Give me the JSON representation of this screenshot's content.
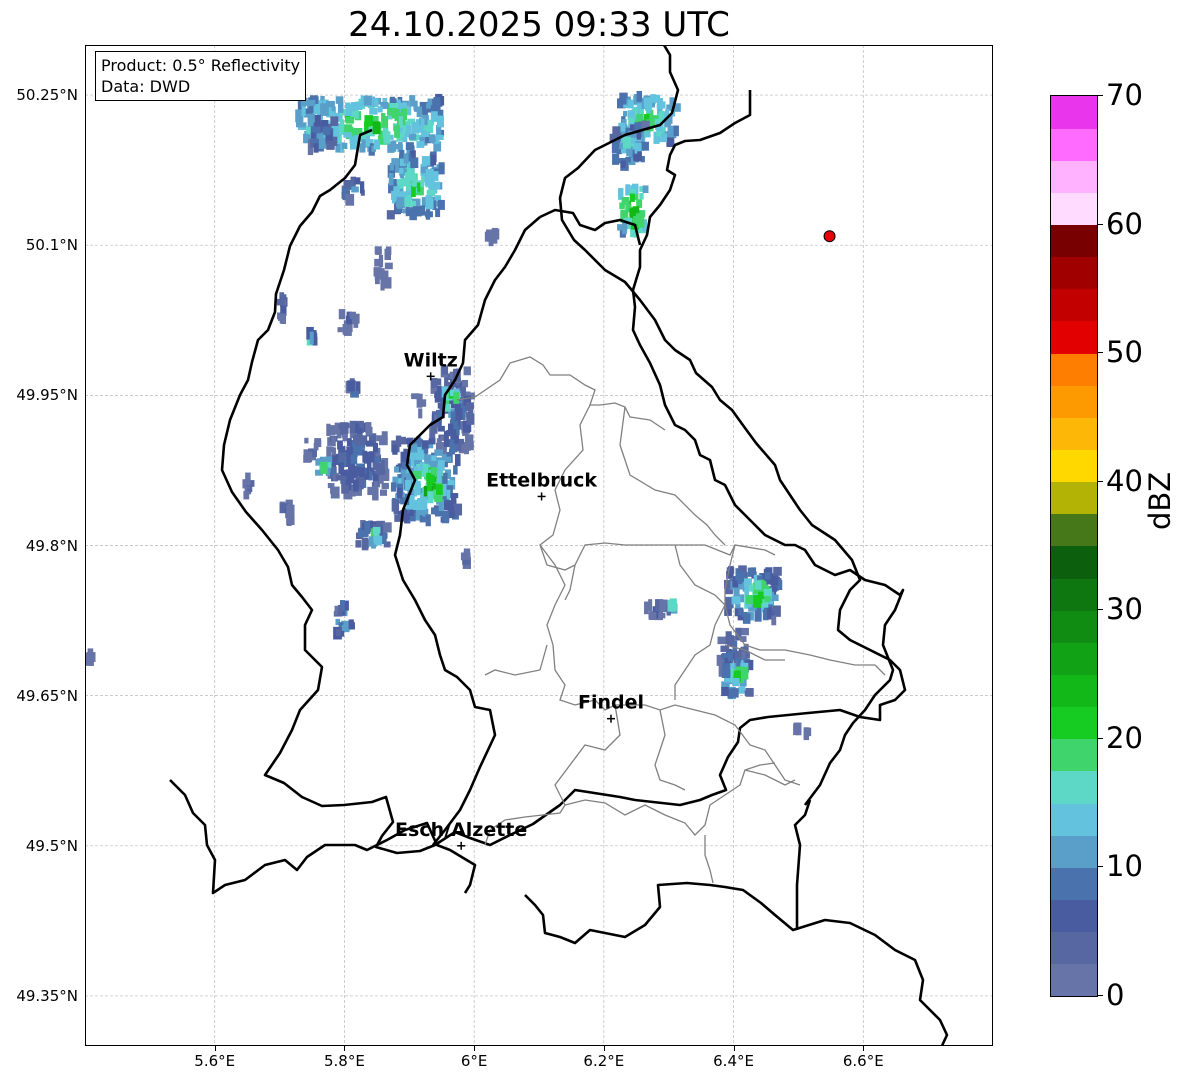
{
  "title": "24.10.2025 09:33 UTC",
  "info": {
    "product": "Product: 0.5° Reflectivity",
    "data": "Data: DWD"
  },
  "map": {
    "lon_range": [
      5.4,
      6.8
    ],
    "lat_range": [
      49.3,
      50.3
    ],
    "lat_ticks": [
      {
        "value": 50.25,
        "label": "50.25°N"
      },
      {
        "value": 50.1,
        "label": "50.1°N"
      },
      {
        "value": 49.95,
        "label": "49.95°N"
      },
      {
        "value": 49.8,
        "label": "49.8°N"
      },
      {
        "value": 49.65,
        "label": "49.65°N"
      },
      {
        "value": 49.5,
        "label": "49.5°N"
      },
      {
        "value": 49.35,
        "label": "49.35°N"
      }
    ],
    "lon_ticks": [
      {
        "value": 5.6,
        "label": "5.6°E"
      },
      {
        "value": 5.8,
        "label": "5.8°E"
      },
      {
        "value": 6.0,
        "label": "6°E"
      },
      {
        "value": 6.2,
        "label": "6.2°E"
      },
      {
        "value": 6.4,
        "label": "6.4°E"
      },
      {
        "value": 6.6,
        "label": "6.6°E"
      }
    ],
    "cities": [
      {
        "name": "Wiltz",
        "lon": 5.933,
        "lat": 49.969
      },
      {
        "name": "Ettelbruck",
        "lon": 6.104,
        "lat": 49.849
      },
      {
        "name": "Findel",
        "lon": 6.211,
        "lat": 49.627
      },
      {
        "name": "Esch/Alzette",
        "lon": 5.98,
        "lat": 49.5
      }
    ],
    "radar_site": {
      "lon": 6.548,
      "lat": 50.109,
      "color": "#e8000b"
    },
    "echoes": [
      {
        "lon": 5.84,
        "lat": 50.22,
        "w": 0.22,
        "h": 0.05,
        "dbz": 22
      },
      {
        "lon": 5.91,
        "lat": 50.16,
        "w": 0.08,
        "h": 0.06,
        "dbz": 20
      },
      {
        "lon": 5.815,
        "lat": 50.155,
        "w": 0.03,
        "h": 0.02,
        "dbz": 15
      },
      {
        "lon": 5.765,
        "lat": 50.21,
        "w": 0.04,
        "h": 0.03,
        "dbz": 14
      },
      {
        "lon": 5.86,
        "lat": 50.08,
        "w": 0.02,
        "h": 0.04,
        "dbz": 5
      },
      {
        "lon": 5.805,
        "lat": 50.025,
        "w": 0.03,
        "h": 0.02,
        "dbz": 6
      },
      {
        "lon": 5.705,
        "lat": 50.04,
        "w": 0.015,
        "h": 0.03,
        "dbz": 8
      },
      {
        "lon": 5.745,
        "lat": 50.005,
        "w": 0.015,
        "h": 0.015,
        "dbz": 18
      },
      {
        "lon": 6.27,
        "lat": 50.225,
        "w": 0.09,
        "h": 0.05,
        "dbz": 20
      },
      {
        "lon": 6.24,
        "lat": 50.2,
        "w": 0.05,
        "h": 0.04,
        "dbz": 17
      },
      {
        "lon": 6.245,
        "lat": 50.135,
        "w": 0.04,
        "h": 0.05,
        "dbz": 24
      },
      {
        "lon": 6.03,
        "lat": 50.108,
        "w": 0.02,
        "h": 0.008,
        "dbz": 6
      },
      {
        "lon": 5.965,
        "lat": 49.935,
        "w": 0.06,
        "h": 0.08,
        "dbz": 12
      },
      {
        "lon": 5.965,
        "lat": 49.945,
        "w": 0.02,
        "h": 0.02,
        "dbz": 24
      },
      {
        "lon": 5.82,
        "lat": 49.885,
        "w": 0.09,
        "h": 0.07,
        "dbz": 12
      },
      {
        "lon": 5.77,
        "lat": 49.88,
        "w": 0.025,
        "h": 0.02,
        "dbz": 18
      },
      {
        "lon": 5.925,
        "lat": 49.865,
        "w": 0.1,
        "h": 0.08,
        "dbz": 18
      },
      {
        "lon": 5.93,
        "lat": 49.86,
        "w": 0.04,
        "h": 0.04,
        "dbz": 26
      },
      {
        "lon": 5.915,
        "lat": 49.94,
        "w": 0.015,
        "h": 0.02,
        "dbz": 4
      },
      {
        "lon": 5.815,
        "lat": 49.955,
        "w": 0.02,
        "h": 0.015,
        "dbz": 13
      },
      {
        "lon": 5.75,
        "lat": 49.895,
        "w": 0.02,
        "h": 0.02,
        "dbz": 3
      },
      {
        "lon": 5.655,
        "lat": 49.86,
        "w": 0.015,
        "h": 0.02,
        "dbz": 4
      },
      {
        "lon": 5.71,
        "lat": 49.835,
        "w": 0.015,
        "h": 0.025,
        "dbz": 10
      },
      {
        "lon": 5.845,
        "lat": 49.81,
        "w": 0.05,
        "h": 0.025,
        "dbz": 14
      },
      {
        "lon": 5.85,
        "lat": 49.81,
        "w": 0.015,
        "h": 0.012,
        "dbz": 22
      },
      {
        "lon": 5.8,
        "lat": 49.725,
        "w": 0.025,
        "h": 0.03,
        "dbz": 16
      },
      {
        "lon": 5.985,
        "lat": 49.785,
        "w": 0.015,
        "h": 0.015,
        "dbz": 6
      },
      {
        "lon": 5.405,
        "lat": 49.685,
        "w": 0.012,
        "h": 0.02,
        "dbz": 4
      },
      {
        "lon": 6.43,
        "lat": 49.75,
        "w": 0.08,
        "h": 0.05,
        "dbz": 17
      },
      {
        "lon": 6.44,
        "lat": 49.75,
        "w": 0.03,
        "h": 0.025,
        "dbz": 26
      },
      {
        "lon": 6.4,
        "lat": 49.695,
        "w": 0.04,
        "h": 0.04,
        "dbz": 10
      },
      {
        "lon": 6.405,
        "lat": 49.67,
        "w": 0.04,
        "h": 0.04,
        "dbz": 19
      },
      {
        "lon": 6.41,
        "lat": 49.67,
        "w": 0.015,
        "h": 0.015,
        "dbz": 26
      },
      {
        "lon": 6.285,
        "lat": 49.735,
        "w": 0.04,
        "h": 0.015,
        "dbz": 8
      },
      {
        "lon": 6.305,
        "lat": 49.74,
        "w": 0.012,
        "h": 0.008,
        "dbz": 17
      },
      {
        "lon": 6.505,
        "lat": 49.615,
        "w": 0.025,
        "h": 0.008,
        "dbz": 4
      }
    ]
  },
  "colorbar": {
    "label": "dBZ",
    "ticks": [
      "0",
      "10",
      "20",
      "30",
      "40",
      "50",
      "60",
      "70"
    ],
    "min": 0,
    "max": 70,
    "step": 2.5,
    "colors": [
      "#6674a7",
      "#5767a1",
      "#4a5ca0",
      "#4a72ad",
      "#5a9fca",
      "#63c2de",
      "#5ed8c6",
      "#3fd46c",
      "#16cc22",
      "#12b718",
      "#12a216",
      "#108c12",
      "#0e770f",
      "#0b5f0d",
      "#46781a",
      "#b3b305",
      "#ffd800",
      "#fdb706",
      "#fd9a02",
      "#fd7e00",
      "#e30000",
      "#c30000",
      "#a00000",
      "#780000",
      "#ffdcff",
      "#ffb2ff",
      "#fe6bfe",
      "#e935ec"
    ]
  }
}
